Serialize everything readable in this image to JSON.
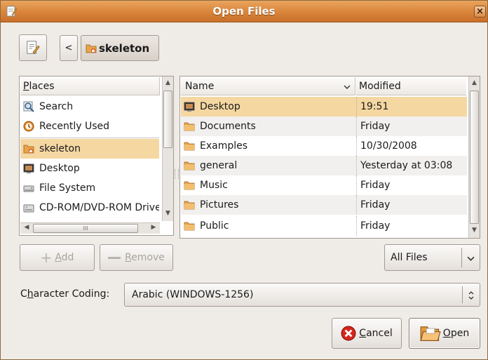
{
  "window": {
    "title": "Open Files",
    "close_glyph": "×"
  },
  "location": {
    "current": "skeleton",
    "back_glyph": "<"
  },
  "places": {
    "header": "Places",
    "items": [
      {
        "label": "Search",
        "icon": "search-icon"
      },
      {
        "label": "Recently Used",
        "icon": "recent-icon"
      },
      {
        "label": "skeleton",
        "icon": "home-folder-icon",
        "selected": true
      },
      {
        "label": "Desktop",
        "icon": "desktop-icon"
      },
      {
        "label": "File System",
        "icon": "drive-icon"
      },
      {
        "label": "CD-ROM/DVD-ROM Drive",
        "icon": "cdrom-icon"
      }
    ],
    "hscroll_grip": "III"
  },
  "files": {
    "name_header": "Name",
    "modified_header": "Modified",
    "rows": [
      {
        "name": "Desktop",
        "modified": "19:51",
        "icon": "desktop-icon",
        "selected": true
      },
      {
        "name": "Documents",
        "modified": "Friday",
        "icon": "folder-icon"
      },
      {
        "name": "Examples",
        "modified": "10/30/2008",
        "icon": "folder-icon"
      },
      {
        "name": "general",
        "modified": "Yesterday at 03:08",
        "icon": "folder-icon"
      },
      {
        "name": "Music",
        "modified": "Friday",
        "icon": "folder-icon"
      },
      {
        "name": "Pictures",
        "modified": "Friday",
        "icon": "folder-icon"
      },
      {
        "name": "Public",
        "modified": "Friday",
        "icon": "folder-icon"
      }
    ]
  },
  "buttons": {
    "add_pre": "",
    "add_key": "A",
    "add_post": "dd",
    "remove_pre": "",
    "remove_key": "R",
    "remove_post": "emove",
    "cancel_pre": "",
    "cancel_key": "C",
    "cancel_post": "ancel",
    "open_pre": "",
    "open_key": "O",
    "open_post": "pen"
  },
  "filter": {
    "value": "All Files"
  },
  "encoding": {
    "label_pre": "C",
    "label_key": "h",
    "label_post": "aracter Coding:",
    "value": "Arabic (WINDOWS-1256)"
  },
  "colors": {
    "title_bar": "#d9843a",
    "selection": "#f5d7a2",
    "window_bg": "#efebe7"
  }
}
